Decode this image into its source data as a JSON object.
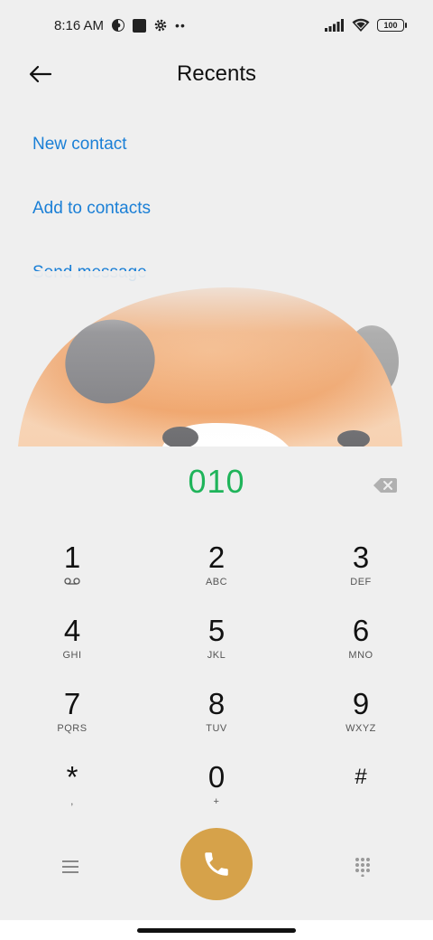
{
  "status_bar": {
    "time": "8:16 AM",
    "battery": "100",
    "icons": [
      "theme-icon",
      "square-icon",
      "settings-gear-icon",
      "more-dots-icon",
      "signal-icon",
      "wifi-icon",
      "battery-icon"
    ]
  },
  "header": {
    "title": "Recents",
    "back_icon": "back-arrow-icon"
  },
  "actions": [
    {
      "label": "New contact"
    },
    {
      "label": "Add to contacts"
    },
    {
      "label": "Send message"
    }
  ],
  "dialer": {
    "number": "010",
    "backspace_icon": "backspace-icon",
    "keys": [
      {
        "digit": "1",
        "sub": "",
        "sub_icon": "voicemail-icon"
      },
      {
        "digit": "2",
        "sub": "ABC"
      },
      {
        "digit": "3",
        "sub": "DEF"
      },
      {
        "digit": "4",
        "sub": "GHI"
      },
      {
        "digit": "5",
        "sub": "JKL"
      },
      {
        "digit": "6",
        "sub": "MNO"
      },
      {
        "digit": "7",
        "sub": "PQRS"
      },
      {
        "digit": "8",
        "sub": "TUV"
      },
      {
        "digit": "9",
        "sub": "WXYZ"
      },
      {
        "digit": "*",
        "sub": ","
      },
      {
        "digit": "0",
        "sub": "+"
      },
      {
        "digit": "#",
        "sub": ""
      }
    ],
    "menu_icon": "menu-icon",
    "call_icon": "phone-icon",
    "keypad_icon": "keypad-grid-icon"
  },
  "colors": {
    "accent_blue": "#1a7fd6",
    "number_green": "#1fb45a",
    "call_button": "#d6a24a",
    "background": "#efefef"
  }
}
